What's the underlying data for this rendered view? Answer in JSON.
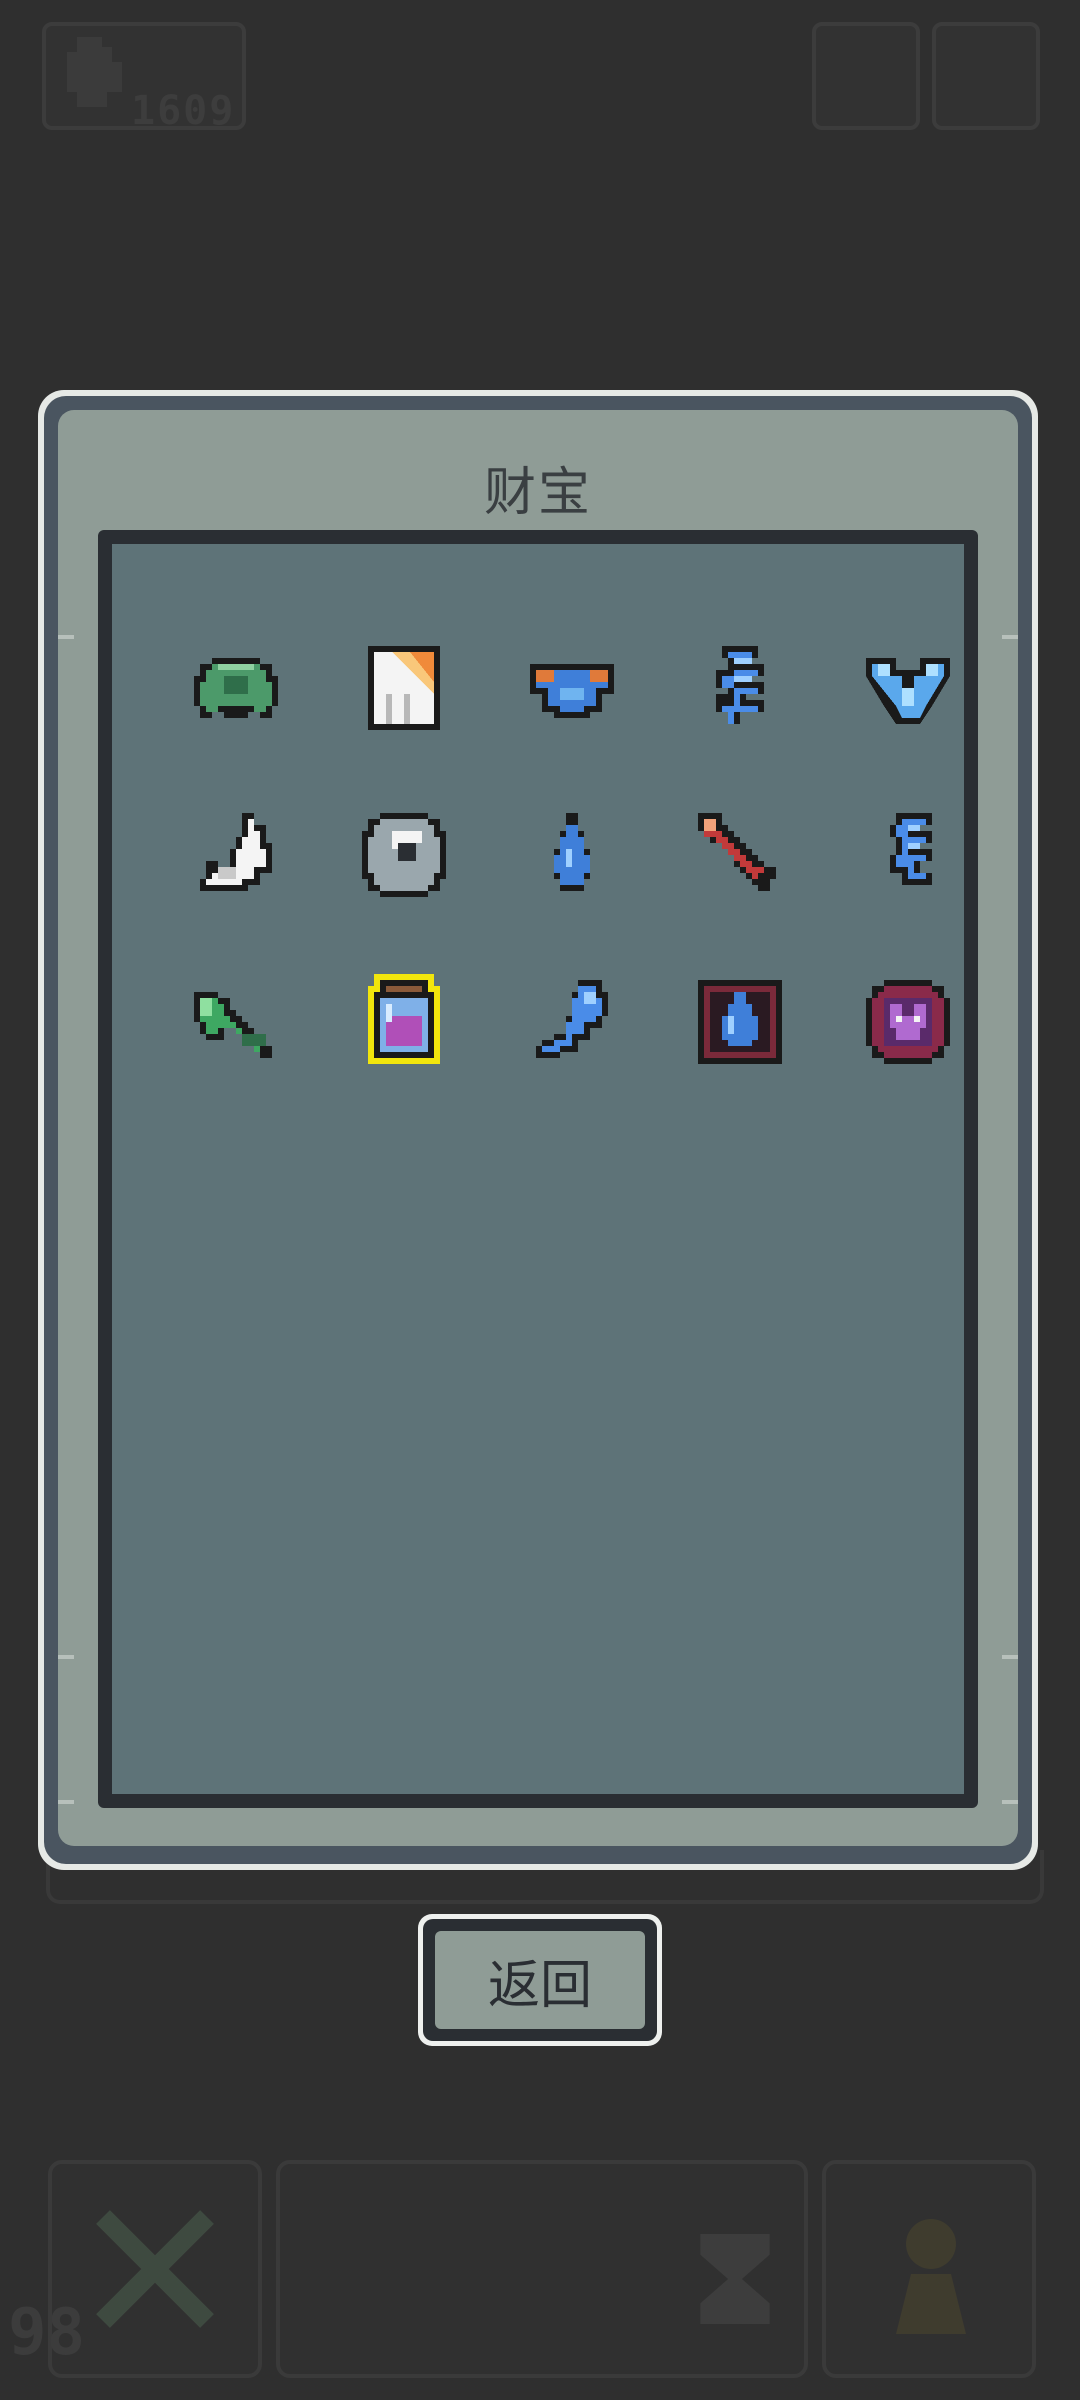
{
  "hud": {
    "gold_amount": "1609",
    "gold_icon": "pixel-fist-icon",
    "level_number": "98"
  },
  "panel": {
    "title": "财宝"
  },
  "items": [
    {
      "icon": "turtle-shell-icon"
    },
    {
      "icon": "orange-banner-icon"
    },
    {
      "icon": "blue-mask-icon"
    },
    {
      "icon": "blue-wing-icon"
    },
    {
      "icon": "ice-crystal-icon"
    },
    {
      "icon": "white-fang-icon"
    },
    {
      "icon": "stone-orb-icon"
    },
    {
      "icon": "water-drop-icon"
    },
    {
      "icon": "red-arrow-icon"
    },
    {
      "icon": "blue-feather-icon"
    },
    {
      "icon": "green-axe-icon"
    },
    {
      "icon": "potion-jar-icon",
      "selected": true
    },
    {
      "icon": "blue-spirit-icon"
    },
    {
      "icon": "water-rune-card-icon"
    },
    {
      "icon": "demon-medal-icon"
    }
  ],
  "buttons": {
    "back_label": "返回"
  },
  "colors": {
    "background": "#2f2f2f",
    "panel_face": "#8f9c96",
    "content_bg": "#5e7378",
    "selection": "#f2e60c"
  }
}
